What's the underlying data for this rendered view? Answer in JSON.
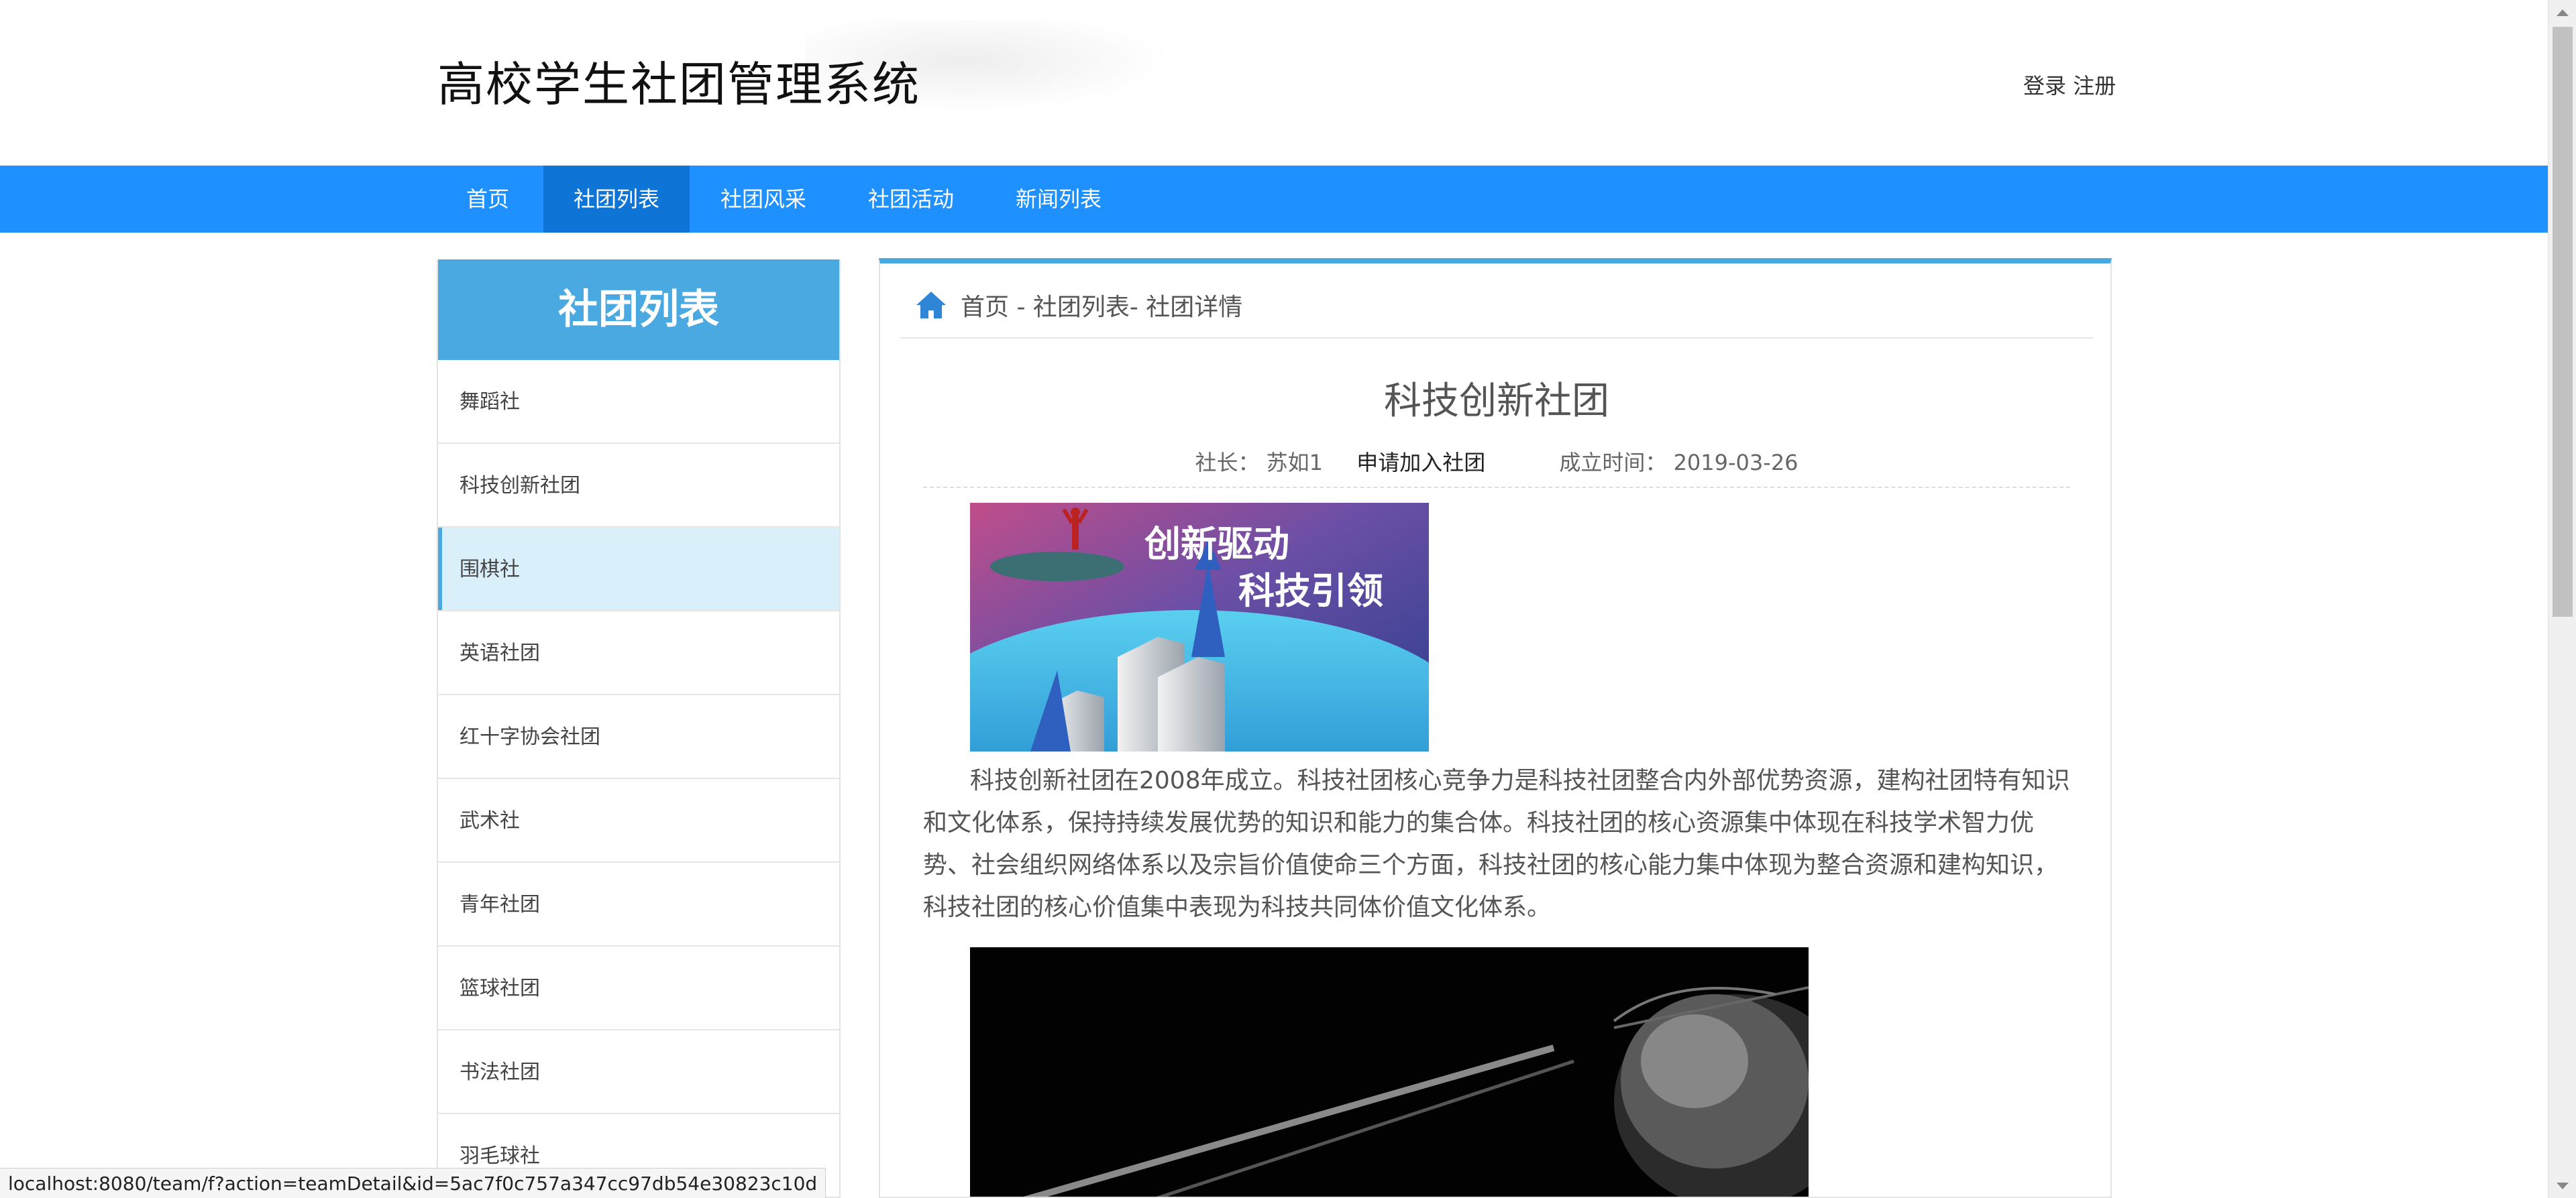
{
  "header": {
    "site_title": "高校学生社团管理系统",
    "login_label": "登录",
    "register_label": "注册"
  },
  "nav": {
    "items": [
      {
        "label": "首页"
      },
      {
        "label": "社团列表"
      },
      {
        "label": "社团风采"
      },
      {
        "label": "社团活动"
      },
      {
        "label": "新闻列表"
      }
    ],
    "active_index": 1
  },
  "sidebar": {
    "title": "社团列表",
    "items": [
      {
        "label": "舞蹈社"
      },
      {
        "label": "科技创新社团"
      },
      {
        "label": "围棋社"
      },
      {
        "label": "英语社团"
      },
      {
        "label": "红十字协会社团"
      },
      {
        "label": "武术社"
      },
      {
        "label": "青年社团"
      },
      {
        "label": "篮球社团"
      },
      {
        "label": "书法社团"
      },
      {
        "label": "羽毛球社"
      }
    ],
    "active_index": 2
  },
  "breadcrumb": {
    "text": "首页 - 社团列表- 社团详情",
    "icon": "home-icon"
  },
  "detail": {
    "title": "科技创新社团",
    "leader_label": "社长：",
    "leader_name": "苏如1",
    "apply_label": "申请加入社团",
    "founded_label": "成立时间：",
    "founded_date": "2019-03-26",
    "banner_text_line1": "创新驱动",
    "banner_text_line2": "科技引领",
    "description": "科技创新社团在2008年成立。科技社团核心竞争力是科技社团整合内外部优势资源，建构社团特有知识和文化体系，保持持续发展优势的知识和能力的集合体。科技社团的核心资源集中体现在科技学术智力优势、社会组织网络体系以及宗旨价值使命三个方面，科技社团的核心能力集中体现为整合资源和建构知识，科技社团的核心价值集中表现为科技共同体价值文化体系。"
  },
  "statusbar": {
    "url": "localhost:8080/team/f?action=teamDetail&id=5ac7f0c757a347cc97db54e30823c10d"
  },
  "colors": {
    "nav_bg": "#1e90ff",
    "nav_active": "#0e74d6",
    "sidebar_head": "#4aa9e0",
    "sidebar_active_bg": "#d9f0fb"
  }
}
